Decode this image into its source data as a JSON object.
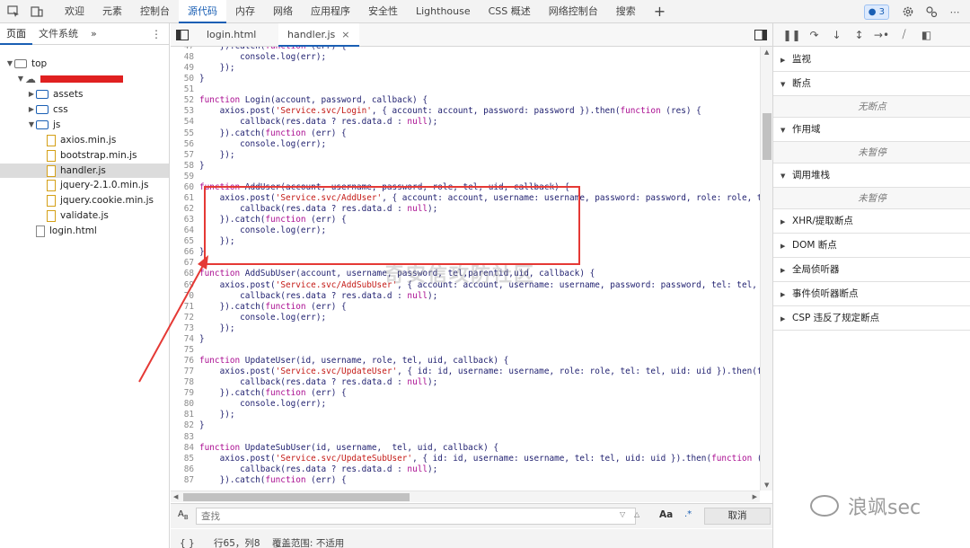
{
  "topbar": {
    "tabs": [
      "欢迎",
      "元素",
      "控制台",
      "源代码",
      "内存",
      "网络",
      "应用程序",
      "安全性",
      "Lighthouse",
      "CSS 概述",
      "网络控制台",
      "搜索"
    ],
    "active_tab": "源代码",
    "plus": "+",
    "issues_count": "3"
  },
  "navigator": {
    "tabs": [
      "页面",
      "文件系统"
    ],
    "more": "»",
    "menu": "⋮",
    "tree": [
      {
        "label": "top",
        "type": "frame",
        "level": 0,
        "expanded": true
      },
      {
        "label": "",
        "type": "origin",
        "level": 1,
        "expanded": true,
        "redacted": true
      },
      {
        "label": "assets",
        "type": "folder",
        "level": 2,
        "expanded": false
      },
      {
        "label": "css",
        "type": "folder",
        "level": 2,
        "expanded": false
      },
      {
        "label": "js",
        "type": "folder",
        "level": 2,
        "expanded": true
      },
      {
        "label": "axios.min.js",
        "type": "file",
        "level": 3
      },
      {
        "label": "bootstrap.min.js",
        "type": "file",
        "level": 3
      },
      {
        "label": "handler.js",
        "type": "file",
        "level": 3,
        "selected": true
      },
      {
        "label": "jquery-2.1.0.min.js",
        "type": "file",
        "level": 3
      },
      {
        "label": "jquery.cookie.min.js",
        "type": "file",
        "level": 3
      },
      {
        "label": "validate.js",
        "type": "file",
        "level": 3
      },
      {
        "label": "login.html",
        "type": "html",
        "level": 2
      }
    ]
  },
  "editor": {
    "tabs": [
      "login.html",
      "handler.js"
    ],
    "active_tab": "handler.js",
    "close": "×",
    "lines": [
      {
        "n": "47",
        "t": "    }).catch(function (err) {"
      },
      {
        "n": "48",
        "t": "        console.log(err);"
      },
      {
        "n": "49",
        "t": "    });"
      },
      {
        "n": "50",
        "t": "}"
      },
      {
        "n": "51",
        "t": ""
      },
      {
        "n": "52",
        "t": "function Login(account, password, callback) {"
      },
      {
        "n": "53",
        "t": "    axios.post('Service.svc/Login', { account: account, password: password }).then(function (res) {"
      },
      {
        "n": "54",
        "t": "        callback(res.data ? res.data.d : null);"
      },
      {
        "n": "55",
        "t": "    }).catch(function (err) {"
      },
      {
        "n": "56",
        "t": "        console.log(err);"
      },
      {
        "n": "57",
        "t": "    });"
      },
      {
        "n": "58",
        "t": "}"
      },
      {
        "n": "59",
        "t": ""
      },
      {
        "n": "60",
        "t": "function AddUser(account, username, password, role, tel, uid, callback) {"
      },
      {
        "n": "61",
        "t": "    axios.post('Service.svc/AddUser', { account: account, username: username, password: password, role: role, t"
      },
      {
        "n": "62",
        "t": "        callback(res.data ? res.data.d : null);"
      },
      {
        "n": "63",
        "t": "    }).catch(function (err) {"
      },
      {
        "n": "64",
        "t": "        console.log(err);"
      },
      {
        "n": "65",
        "t": "    });"
      },
      {
        "n": "66",
        "t": "}"
      },
      {
        "n": "67",
        "t": ""
      },
      {
        "n": "68",
        "t": "function AddSubUser(account, username, password, tel,parentid,uid, callback) {"
      },
      {
        "n": "69",
        "t": "    axios.post('Service.svc/AddSubUser', { account: account, username: username, password: password, tel: tel,"
      },
      {
        "n": "70",
        "t": "        callback(res.data ? res.data.d : null);"
      },
      {
        "n": "71",
        "t": "    }).catch(function (err) {"
      },
      {
        "n": "72",
        "t": "        console.log(err);"
      },
      {
        "n": "73",
        "t": "    });"
      },
      {
        "n": "74",
        "t": "}"
      },
      {
        "n": "75",
        "t": ""
      },
      {
        "n": "76",
        "t": "function UpdateUser(id, username, role, tel, uid, callback) {"
      },
      {
        "n": "77",
        "t": "    axios.post('Service.svc/UpdateUser', { id: id, username: username, role: role, tel: tel, uid: uid }).then(f"
      },
      {
        "n": "78",
        "t": "        callback(res.data ? res.data.d : null);"
      },
      {
        "n": "79",
        "t": "    }).catch(function (err) {"
      },
      {
        "n": "80",
        "t": "        console.log(err);"
      },
      {
        "n": "81",
        "t": "    });"
      },
      {
        "n": "82",
        "t": "}"
      },
      {
        "n": "83",
        "t": ""
      },
      {
        "n": "84",
        "t": "function UpdateSubUser(id, username,  tel, uid, callback) {"
      },
      {
        "n": "85",
        "t": "    axios.post('Service.svc/UpdateSubUser', { id: id, username: username, tel: tel, uid: uid }).then(function ("
      },
      {
        "n": "86",
        "t": "        callback(res.data ? res.data.d : null);"
      },
      {
        "n": "87",
        "t": "    }).catch(function (err) {"
      }
    ]
  },
  "search": {
    "placeholder": "查找",
    "match_case": "Aa",
    "regex": ".*",
    "cancel": "取消"
  },
  "status": {
    "braces": "{ }",
    "position": "行65，列8",
    "coverage": "覆盖范围: 不适用"
  },
  "debugger": {
    "sections": [
      {
        "label": "监视",
        "expanded": false
      },
      {
        "label": "断点",
        "expanded": true,
        "empty": "无断点"
      },
      {
        "label": "作用域",
        "expanded": true,
        "empty": "未暂停"
      },
      {
        "label": "调用堆栈",
        "expanded": true,
        "empty": "未暂停"
      },
      {
        "label": "XHR/提取断点",
        "expanded": false
      },
      {
        "label": "DOM 断点",
        "expanded": false
      },
      {
        "label": "全局侦听器",
        "expanded": false
      },
      {
        "label": "事件侦听器断点",
        "expanded": false
      },
      {
        "label": "CSP 违反了规定断点",
        "expanded": false
      }
    ]
  },
  "watermark": {
    "text": "浪飒sec",
    "ghost": "奇安信攻防社区"
  },
  "colors": {
    "accent": "#1a5fb4",
    "highlight_box": "#e53935",
    "keyword": "#aa0d91",
    "string": "#c41a16"
  }
}
